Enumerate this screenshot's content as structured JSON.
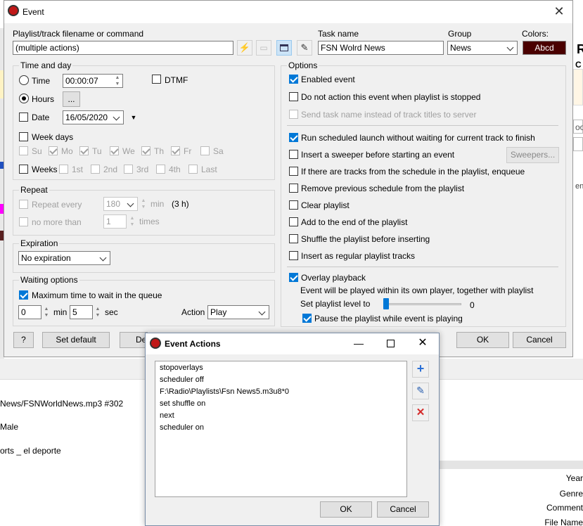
{
  "background": {
    "right_letter_r": "R",
    "right_letter_c": "C",
    "right_oo": "oo",
    "right_eni": "eni",
    "left_lines": [
      "News/FSNWorldNews.mp3 #302",
      "Male",
      "orts _ el deporte"
    ],
    "right_labels": [
      "Year",
      "Genre",
      "Comment",
      "File Name"
    ]
  },
  "event": {
    "title": "Event",
    "filename_label": "Playlist/track filename or command",
    "filename_value": "(multiple actions)",
    "taskname_label": "Task name",
    "taskname_value": "FSN Wolrd News",
    "group_label": "Group",
    "group_value": "News",
    "colors_label": "Colors:",
    "color_sample": "Abcd",
    "color_bg": "#4a0000",
    "timeday": {
      "label": "Time and day",
      "time_label": "Time",
      "time_value": "00:00:07",
      "dtmf_label": "DTMF",
      "hours_label": "Hours",
      "hours_btn": "...",
      "date_label": "Date",
      "date_value": "16/05/2020",
      "weekdays_label": "Week days",
      "days": [
        "Su",
        "Mo",
        "Tu",
        "We",
        "Th",
        "Fr",
        "Sa"
      ],
      "days_checked": [
        false,
        true,
        true,
        true,
        true,
        true,
        false
      ],
      "weeks_label": "Weeks",
      "weeks": [
        "1st",
        "2nd",
        "3rd",
        "4th",
        "Last"
      ]
    },
    "repeat": {
      "label": "Repeat",
      "every_label": "Repeat every",
      "every_value": "180",
      "every_unit": "min",
      "every_hint": "(3 h)",
      "nomore_label": "no more than",
      "nomore_value": "1",
      "nomore_unit": "times"
    },
    "expiration": {
      "label": "Expiration",
      "value": "No expiration"
    },
    "waiting": {
      "label": "Waiting options",
      "max_label": "Maximum time to wait in the queue",
      "min_value": "0",
      "min_unit": "min",
      "sec_value": "5",
      "sec_unit": "sec",
      "action_label": "Action",
      "action_value": "Play"
    },
    "options": {
      "label": "Options",
      "items": [
        {
          "label": "Enabled event",
          "checked": true
        },
        {
          "label": "Do not action this event when playlist is stopped",
          "checked": false
        },
        {
          "label": "Send task name instead of track titles to server",
          "checked": false
        },
        {
          "label": "Run scheduled launch without waiting for current track to finish",
          "checked": true
        },
        {
          "label": "Insert a sweeper before starting an event",
          "checked": false
        },
        {
          "label": "If there are tracks from the schedule in the playlist, enqueue",
          "checked": false
        },
        {
          "label": "Remove previous schedule from the playlist",
          "checked": false
        },
        {
          "label": "Clear playlist",
          "checked": false
        },
        {
          "label": "Add to the end of the playlist",
          "checked": false
        },
        {
          "label": "Shuffle the playlist before inserting",
          "checked": false
        },
        {
          "label": "Insert as regular playlist tracks",
          "checked": false
        },
        {
          "label": "Overlay playback",
          "checked": true
        }
      ],
      "sweepers_btn": "Sweepers...",
      "overlay_note": "Event will be played within its own player, together with playlist",
      "level_label": "Set playlist level to",
      "level_value": "0",
      "pause_label": "Pause the playlist while event is playing"
    },
    "buttons": {
      "help": "?",
      "set_default": "Set default",
      "de": "De",
      "ok": "OK",
      "cancel": "Cancel"
    }
  },
  "actions": {
    "title": "Event Actions",
    "lines": [
      "stopoverlays",
      "scheduler off",
      "F:\\Radio\\Playlists\\Fsn News5.m3u8*0",
      "set shuffle on",
      "next",
      "scheduler on"
    ],
    "ok": "OK",
    "cancel": "Cancel"
  }
}
